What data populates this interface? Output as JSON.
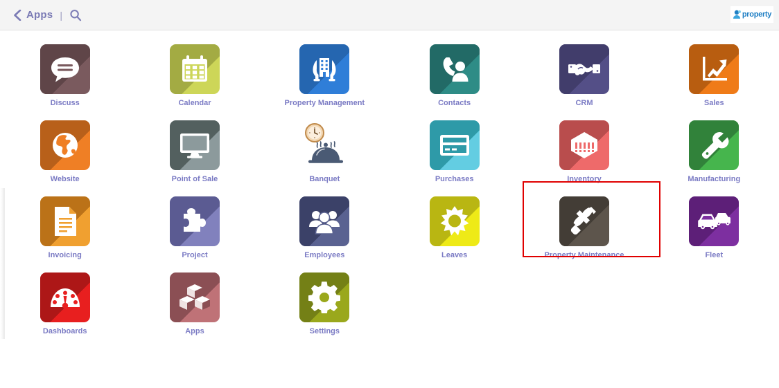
{
  "header": {
    "back_icon": "chevron-left-icon",
    "apps_label": "Apps",
    "divider": "|",
    "search_icon": "search-icon",
    "logo_text": "property",
    "logo_icon": "property-brand-icon",
    "bg_color": "#f4f4f4",
    "text_color": "#7b7bb5",
    "logo_color": "#1f7fc4"
  },
  "selection": {
    "highlight_color": "#e00000",
    "selected_app": "Property Maintenance"
  },
  "grid": {
    "label_color": "#7b7bc4",
    "rows": [
      [
        {
          "label": "Discuss",
          "icon": "speech-bubble-icon",
          "bg": "#7a5a5e",
          "shadow": "#5f4548",
          "fg": "#ffffff"
        },
        {
          "label": "Calendar",
          "icon": "calendar-icon",
          "bg": "#cdd658",
          "shadow": "#a3ab43",
          "fg": "#ffffff"
        },
        {
          "label": "Property Management",
          "icon": "hands-building-icon",
          "bg": "#2f7ed8",
          "shadow": "#2566b0",
          "fg": "#ffffff"
        },
        {
          "label": "Contacts",
          "icon": "phone-person-icon",
          "bg": "#2e8c86",
          "shadow": "#226a66",
          "fg": "#ffffff"
        },
        {
          "label": "CRM",
          "icon": "handshake-icon",
          "bg": "#544f87",
          "shadow": "#413d6b",
          "fg": "#ffffff"
        },
        {
          "label": "Sales",
          "icon": "growth-chart-icon",
          "bg": "#ef7b18",
          "shadow": "#b85d10",
          "fg": "#ffffff"
        }
      ],
      [
        {
          "label": "Website",
          "icon": "globe-icon",
          "bg": "#ef7f25",
          "shadow": "#b8601a",
          "fg": "#ffffff"
        },
        {
          "label": "Point of Sale",
          "icon": "monitor-icon",
          "bg": "#8c9a9c",
          "shadow": "#53605f",
          "fg": "#ffffff"
        },
        {
          "label": "Banquet",
          "icon": "cloche-clock-icon",
          "bg": "transparent",
          "shadow": "transparent",
          "fg": "#4a5a74"
        },
        {
          "label": "Purchases",
          "icon": "credit-card-icon",
          "bg": "#63cde2",
          "shadow": "#2e9aa8",
          "fg": "#ffffff"
        },
        {
          "label": "Inventory",
          "icon": "warehouse-icon",
          "bg": "#ee6a6a",
          "shadow": "#b94d4d",
          "fg": "#ffffff"
        },
        {
          "label": "Manufacturing",
          "icon": "wrench-icon",
          "bg": "#46b54d",
          "shadow": "#31823a",
          "fg": "#ffffff"
        }
      ],
      [
        {
          "label": "Invoicing",
          "icon": "document-icon",
          "bg": "#f0a030",
          "shadow": "#bb7218",
          "fg": "#ffffff"
        },
        {
          "label": "Project",
          "icon": "puzzle-piece-icon",
          "bg": "#8181bd",
          "shadow": "#5b5b92",
          "fg": "#ffffff"
        },
        {
          "label": "Employees",
          "icon": "people-group-icon",
          "bg": "#5a6291",
          "shadow": "#3b4168",
          "fg": "#ffffff"
        },
        {
          "label": "Leaves",
          "icon": "sun-icon",
          "bg": "#eeea17",
          "shadow": "#b9b612",
          "fg": "#ffffff"
        },
        {
          "label": "Property Maintenance",
          "icon": "hammer-icon",
          "bg": "#5d554c",
          "shadow": "#433d36",
          "fg": "#ffffff",
          "selected": true
        },
        {
          "label": "Fleet",
          "icon": "cars-icon",
          "bg": "#7d2fa0",
          "shadow": "#5d1f78",
          "fg": "#ffffff"
        }
      ],
      [
        {
          "label": "Dashboards",
          "icon": "gauge-icon",
          "bg": "#e81f1f",
          "shadow": "#ad1717",
          "fg": "#ffffff"
        },
        {
          "label": "Apps",
          "icon": "boxes-icon",
          "bg": "#bf7277",
          "shadow": "#8b4f54",
          "fg": "#ffffff"
        },
        {
          "label": "Settings",
          "icon": "gear-icon",
          "bg": "#9aa81c",
          "shadow": "#748016",
          "fg": "#ffffff"
        }
      ]
    ]
  }
}
